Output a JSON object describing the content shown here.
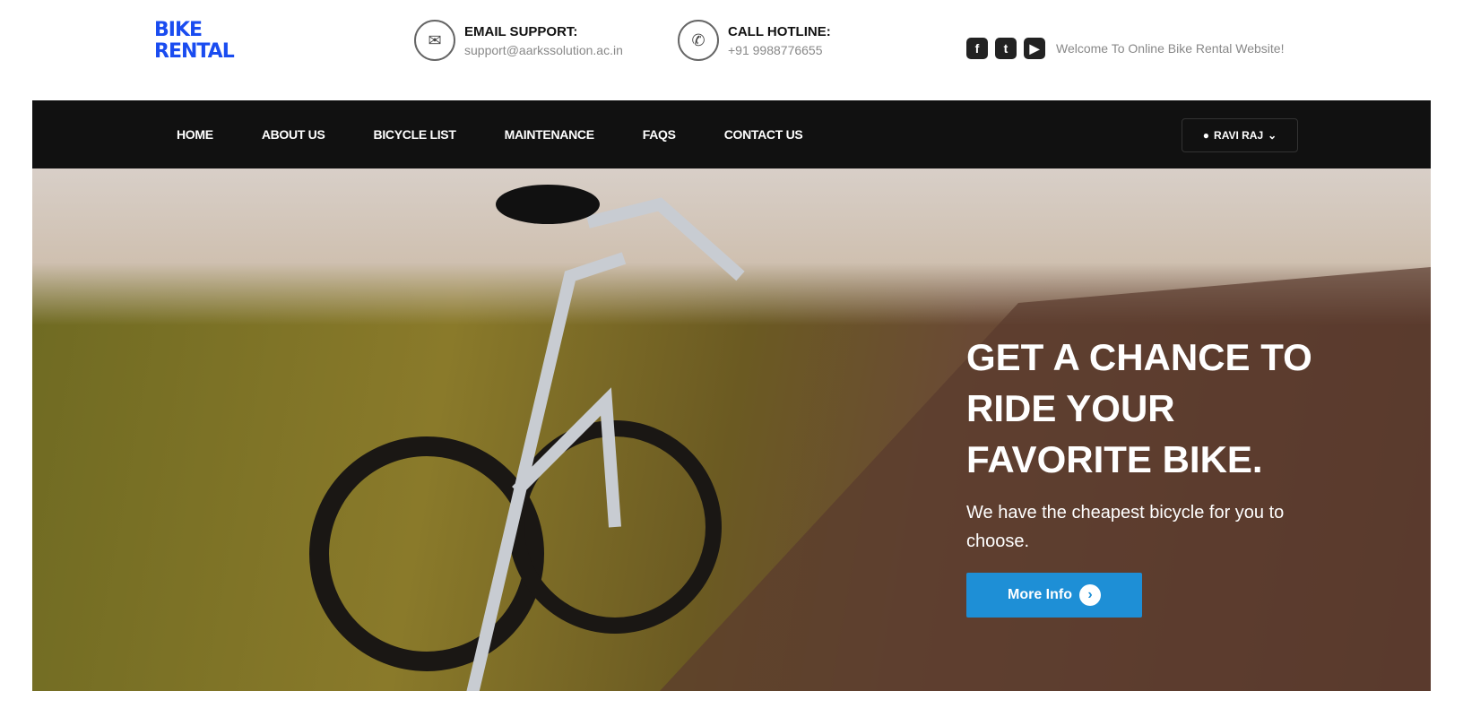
{
  "logo": {
    "line1": "BIKE",
    "line2": "RENTAL"
  },
  "email": {
    "icon": "envelope-icon",
    "label": "EMAIL SUPPORT:",
    "value": "support@aarkssolution.ac.in"
  },
  "hotline": {
    "icon": "phone-icon",
    "label": "CALL HOTLINE:",
    "value": "+91 9988776655"
  },
  "social": {
    "icons": [
      "facebook-icon",
      "twitter-icon",
      "youtube-icon"
    ],
    "welcome": "Welcome To Online Bike Rental Website!"
  },
  "nav": {
    "items": [
      "HOME",
      "ABOUT US",
      "BICYCLE LIST",
      "MAINTENANCE",
      "FAQS",
      "CONTACT US"
    ],
    "user": "RAVI RAJ"
  },
  "hero": {
    "headline": "GET A CHANCE TO RIDE YOUR FAVORITE BIKE.",
    "subtitle": "We have the cheapest bicycle for you to choose.",
    "button": "More Info",
    "button_color": "#1e8fd6"
  }
}
